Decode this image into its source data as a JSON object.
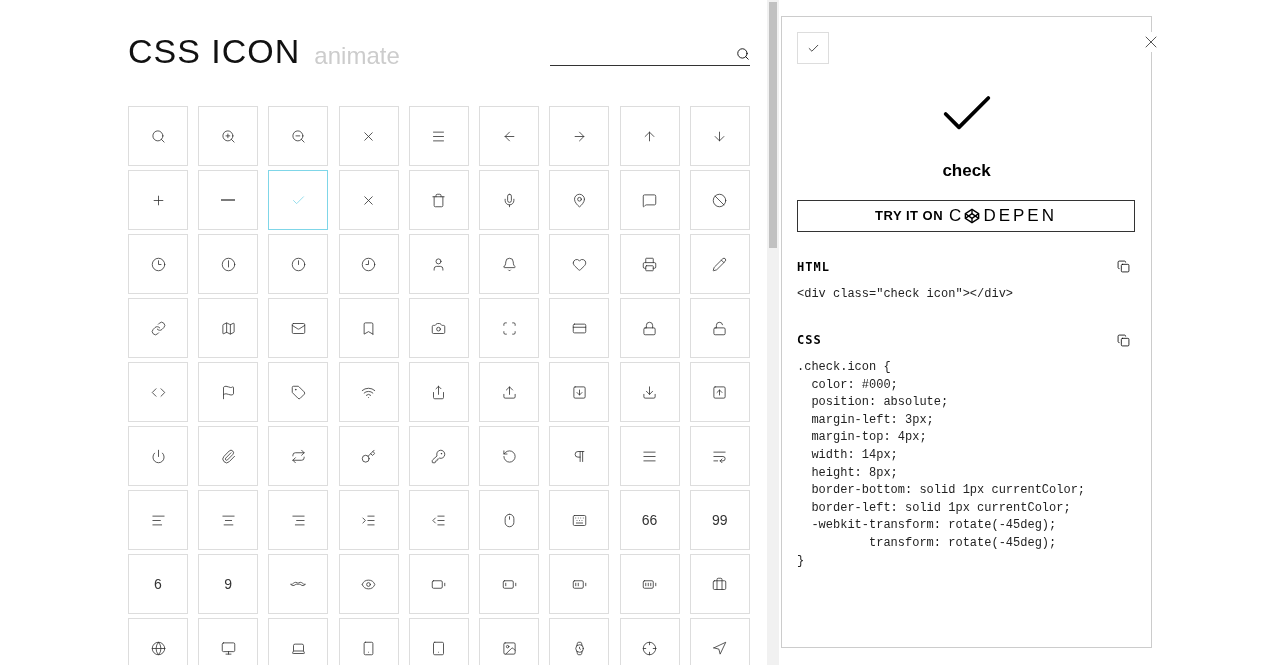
{
  "header": {
    "title": "CSS ICON",
    "subtitle": "animate"
  },
  "icons": [
    {
      "kind": "search",
      "selected": false
    },
    {
      "kind": "zoom-in",
      "selected": false
    },
    {
      "kind": "zoom-out",
      "selected": false
    },
    {
      "kind": "close",
      "selected": false
    },
    {
      "kind": "menu",
      "selected": false
    },
    {
      "kind": "arrow-left",
      "selected": false
    },
    {
      "kind": "arrow-right",
      "selected": false
    },
    {
      "kind": "arrow-up",
      "selected": false
    },
    {
      "kind": "arrow-down",
      "selected": false
    },
    {
      "kind": "plus",
      "selected": false
    },
    {
      "kind": "minus",
      "selected": false
    },
    {
      "kind": "check",
      "selected": true
    },
    {
      "kind": "small-x",
      "selected": false
    },
    {
      "kind": "trash",
      "selected": false
    },
    {
      "kind": "microphone",
      "selected": false
    },
    {
      "kind": "map-pin",
      "selected": false
    },
    {
      "kind": "speech-bubble",
      "selected": false
    },
    {
      "kind": "ban",
      "selected": false
    },
    {
      "kind": "clock-three",
      "selected": false
    },
    {
      "kind": "clock-six",
      "selected": false
    },
    {
      "kind": "clock-twelve",
      "selected": false
    },
    {
      "kind": "clock-nine",
      "selected": false
    },
    {
      "kind": "user",
      "selected": false
    },
    {
      "kind": "bell",
      "selected": false
    },
    {
      "kind": "heart",
      "selected": false
    },
    {
      "kind": "printer",
      "selected": false
    },
    {
      "kind": "pencil",
      "selected": false
    },
    {
      "kind": "link",
      "selected": false
    },
    {
      "kind": "map",
      "selected": false
    },
    {
      "kind": "mail",
      "selected": false
    },
    {
      "kind": "bookmark",
      "selected": false
    },
    {
      "kind": "camera",
      "selected": false
    },
    {
      "kind": "frame-corners",
      "selected": false
    },
    {
      "kind": "credit-card",
      "selected": false
    },
    {
      "kind": "lock",
      "selected": false
    },
    {
      "kind": "unlock",
      "selected": false
    },
    {
      "kind": "code",
      "selected": false
    },
    {
      "kind": "flag",
      "selected": false
    },
    {
      "kind": "tag",
      "selected": false
    },
    {
      "kind": "wifi",
      "selected": false
    },
    {
      "kind": "share",
      "selected": false
    },
    {
      "kind": "upload",
      "selected": false
    },
    {
      "kind": "download-box",
      "selected": false
    },
    {
      "kind": "download",
      "selected": false
    },
    {
      "kind": "upload-box",
      "selected": false
    },
    {
      "kind": "power",
      "selected": false
    },
    {
      "kind": "paperclip",
      "selected": false
    },
    {
      "kind": "repeat",
      "selected": false
    },
    {
      "kind": "key",
      "selected": false
    },
    {
      "kind": "key-round",
      "selected": false
    },
    {
      "kind": "rotate",
      "selected": false
    },
    {
      "kind": "pilcrow",
      "selected": false
    },
    {
      "kind": "justify",
      "selected": false
    },
    {
      "kind": "wrap-text",
      "selected": false
    },
    {
      "kind": "align-left",
      "selected": false
    },
    {
      "kind": "align-center",
      "selected": false
    },
    {
      "kind": "align-right",
      "selected": false
    },
    {
      "kind": "indent",
      "selected": false
    },
    {
      "kind": "outdent",
      "selected": false
    },
    {
      "kind": "mouse",
      "selected": false
    },
    {
      "kind": "keyboard",
      "selected": false
    },
    {
      "kind": "text",
      "text": "66",
      "selected": false
    },
    {
      "kind": "text",
      "text": "99",
      "selected": false
    },
    {
      "kind": "text",
      "text": "6",
      "selected": false
    },
    {
      "kind": "text",
      "text": "9",
      "selected": false
    },
    {
      "kind": "mustache",
      "selected": false
    },
    {
      "kind": "eye",
      "selected": false
    },
    {
      "kind": "battery-empty",
      "selected": false
    },
    {
      "kind": "battery-low",
      "selected": false
    },
    {
      "kind": "battery-medium",
      "selected": false
    },
    {
      "kind": "battery-full",
      "selected": false
    },
    {
      "kind": "briefcase",
      "selected": false
    },
    {
      "kind": "globe",
      "selected": false
    },
    {
      "kind": "monitor",
      "selected": false
    },
    {
      "kind": "laptop",
      "selected": false
    },
    {
      "kind": "smartphone",
      "selected": false
    },
    {
      "kind": "tablet",
      "selected": false
    },
    {
      "kind": "image",
      "selected": false
    },
    {
      "kind": "watch",
      "selected": false
    },
    {
      "kind": "crosshair",
      "selected": false
    },
    {
      "kind": "navigation",
      "selected": false
    }
  ],
  "detail": {
    "name": "check",
    "try_button": {
      "label": "TRY IT ON",
      "brand_start": "C",
      "brand_end": "DEPEN"
    },
    "html": {
      "heading": "HTML",
      "code": [
        "<div class=\"check icon\"></div>"
      ]
    },
    "css": {
      "heading": "CSS",
      "code": [
        ".check.icon {",
        "  color: #000;",
        "  position: absolute;",
        "  margin-left: 3px;",
        "  margin-top: 4px;",
        "  width: 14px;",
        "  height: 8px;",
        "  border-bottom: solid 1px currentColor;",
        "  border-left: solid 1px currentColor;",
        "  -webkit-transform: rotate(-45deg);",
        "          transform: rotate(-45deg);",
        "}"
      ]
    }
  }
}
